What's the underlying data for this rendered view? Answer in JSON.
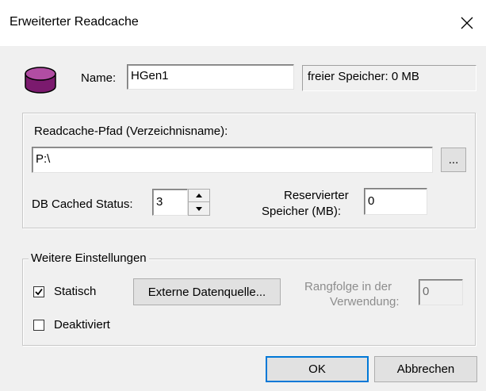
{
  "window": {
    "title": "Erweiterter Readcache",
    "close_glyph": "✕"
  },
  "header": {
    "name_label": "Name:",
    "name_value": "HGen1",
    "free_memory": "freier Speicher:  0 MB"
  },
  "path_group": {
    "label": "Readcache-Pfad (Verzeichnisname):",
    "path_value": "P:\\",
    "browse_label": "...",
    "status_label": "DB Cached Status:",
    "status_value": "3",
    "reserved_label_line1": "Reservierter",
    "reserved_label_line2": "Speicher (MB):",
    "reserved_value": "0"
  },
  "settings_group": {
    "title": "Weitere Einstellungen",
    "static_label": "Statisch",
    "static_checked": true,
    "external_source_label": "Externe Datenquelle...",
    "rank_label_line1": "Rangfolge in der",
    "rank_label_line2": "Verwendung:",
    "rank_value": "0",
    "deactivated_label": "Deaktiviert",
    "deactivated_checked": false
  },
  "buttons": {
    "ok": "OK",
    "cancel": "Abbrechen"
  },
  "colors": {
    "db_icon": "#7b1a6e",
    "accent": "#0078d7"
  },
  "icons": {
    "database": "database-icon",
    "close": "close-icon",
    "check": "checkmark-icon"
  }
}
